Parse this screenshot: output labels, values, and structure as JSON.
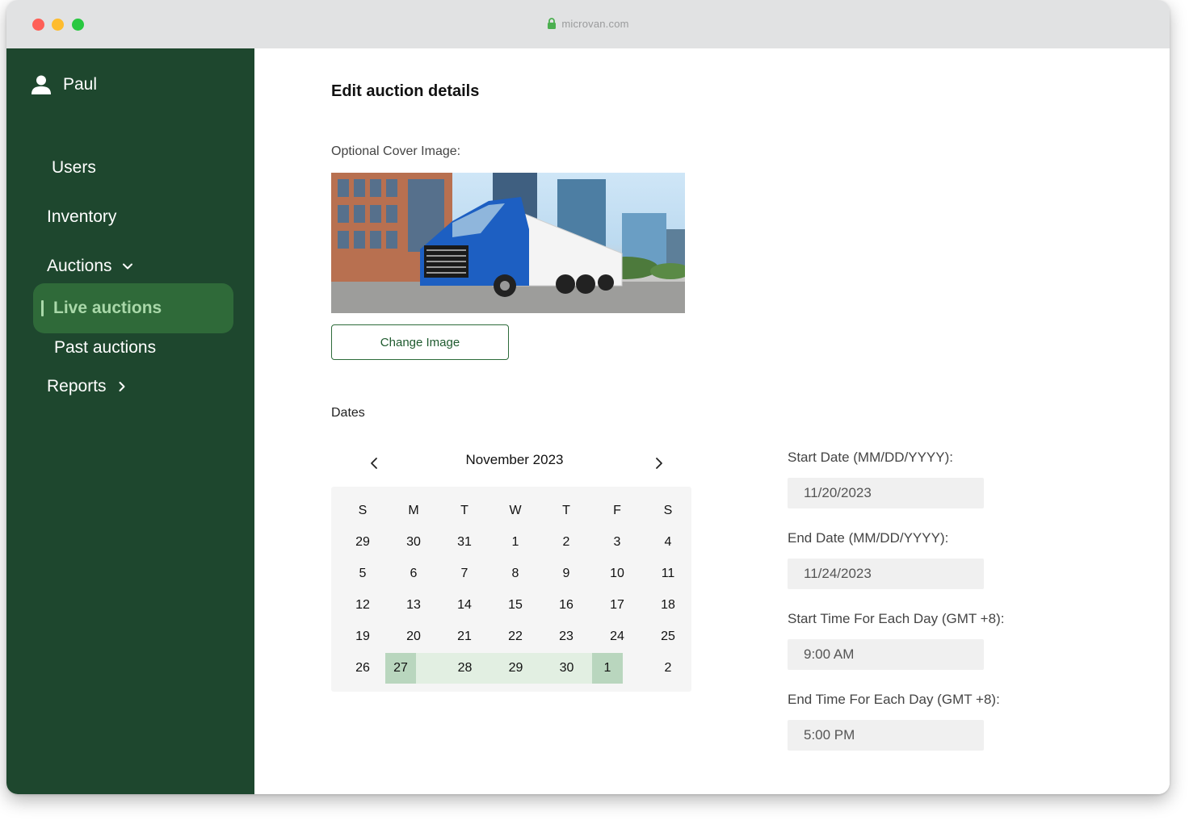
{
  "browser": {
    "url": "microvan.com"
  },
  "user": {
    "name": "Paul"
  },
  "sidebar": {
    "items": {
      "users": "Users",
      "inventory": "Inventory",
      "auctions": "Auctions",
      "live_auctions": "Live auctions",
      "past_auctions": "Past auctions",
      "reports": "Reports"
    }
  },
  "main": {
    "title": "Edit auction details",
    "cover_label": "Optional Cover Image:",
    "change_image": "Change Image",
    "dates_label": "Dates"
  },
  "calendar": {
    "month": "November 2023",
    "weekdays": [
      "S",
      "M",
      "T",
      "W",
      "T",
      "F",
      "S"
    ],
    "weeks": [
      [
        "29",
        "30",
        "31",
        "1",
        "2",
        "3",
        "4"
      ],
      [
        "5",
        "6",
        "7",
        "8",
        "9",
        "10",
        "11"
      ],
      [
        "12",
        "13",
        "14",
        "15",
        "16",
        "17",
        "18"
      ],
      [
        "19",
        "20",
        "21",
        "22",
        "23",
        "24",
        "25"
      ],
      [
        "26",
        "27",
        "28",
        "29",
        "30",
        "1",
        "2"
      ]
    ],
    "selected_range": {
      "start": "27",
      "end": "1"
    }
  },
  "fields": {
    "start_date_label": "Start Date (MM/DD/YYYY):",
    "start_date_value": "11/20/2023",
    "end_date_label": "End Date (MM/DD/YYYY):",
    "end_date_value": "11/24/2023",
    "start_time_label": "Start Time For Each Day (GMT +8):",
    "start_time_value": "9:00 AM",
    "end_time_label": "End Time For Each Day (GMT +8):",
    "end_time_value": "5:00 PM"
  },
  "colors": {
    "sidebar": "#1e472e",
    "active_item": "#2f6a39",
    "active_text": "#a9d8a9",
    "range_fill": "#e2efe2",
    "range_edge": "#b9d6be"
  }
}
